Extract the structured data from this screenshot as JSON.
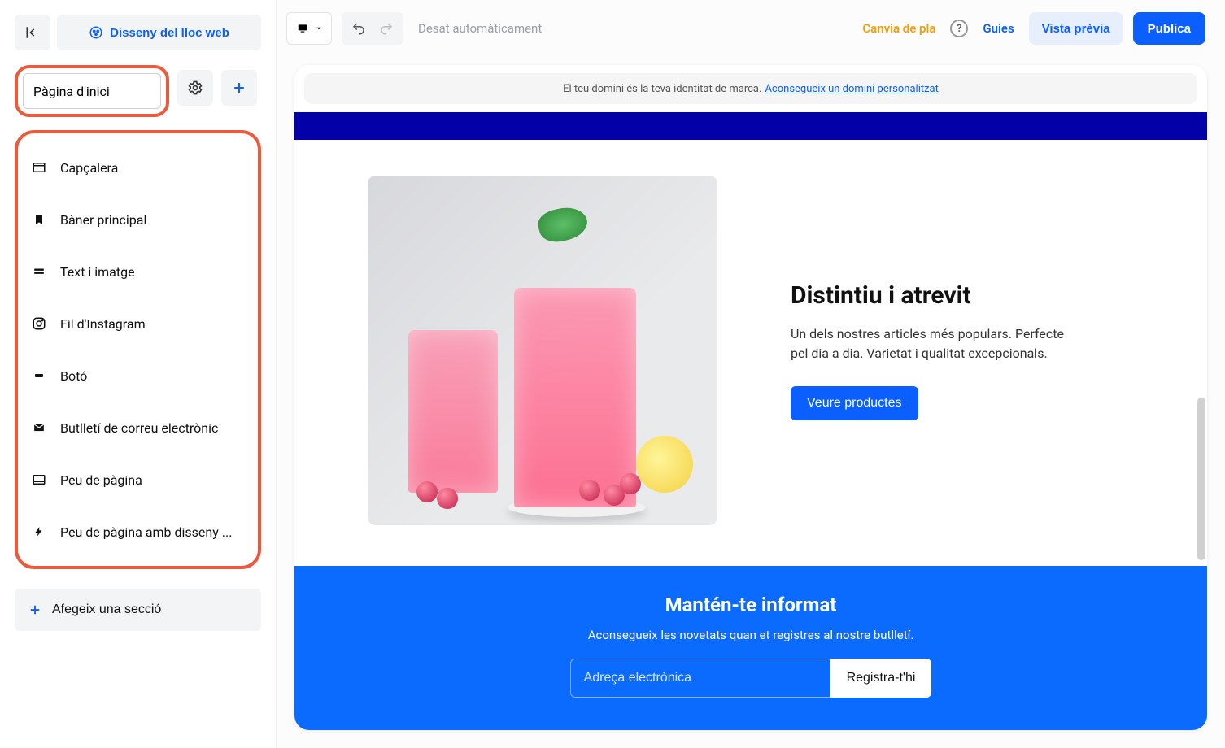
{
  "sidebar": {
    "site_design_label": "Disseny del lloc web",
    "page_select_value": "Pàgina d'inici",
    "sections": [
      {
        "label": "Capçalera",
        "icon": "header-icon"
      },
      {
        "label": "Bàner principal",
        "icon": "bookmark-icon"
      },
      {
        "label": "Text i imatge",
        "icon": "text-image-icon"
      },
      {
        "label": "Fil d'Instagram",
        "icon": "instagram-icon"
      },
      {
        "label": "Botó",
        "icon": "button-icon"
      },
      {
        "label": "Butlletí de correu electrònic",
        "icon": "mail-icon"
      },
      {
        "label": "Peu de pàgina",
        "icon": "footer-icon"
      },
      {
        "label": "Peu de pàgina amb disseny ...",
        "icon": "bolt-icon"
      }
    ],
    "add_section_label": "Afegeix una secció"
  },
  "topbar": {
    "save_status": "Desat automàticament",
    "change_plan": "Canvia de pla",
    "guides": "Guies",
    "preview": "Vista prèvia",
    "publish": "Publica"
  },
  "domain_banner": {
    "text": "El teu domini és la teva identitat de marca.",
    "link": "Aconsegueix un domini personalitzat"
  },
  "feature": {
    "title": "Distintiu i atrevit",
    "body": "Un dels nostres articles més populars. Perfecte pel dia a dia. Varietat i qualitat excepcionals.",
    "cta": "Veure productes"
  },
  "newsletter": {
    "title": "Mantén-te informat",
    "subtitle": "Aconsegueix les novetats quan et registres al nostre butlletí.",
    "placeholder": "Adreça electrònica",
    "button": "Registra-t'hi"
  }
}
